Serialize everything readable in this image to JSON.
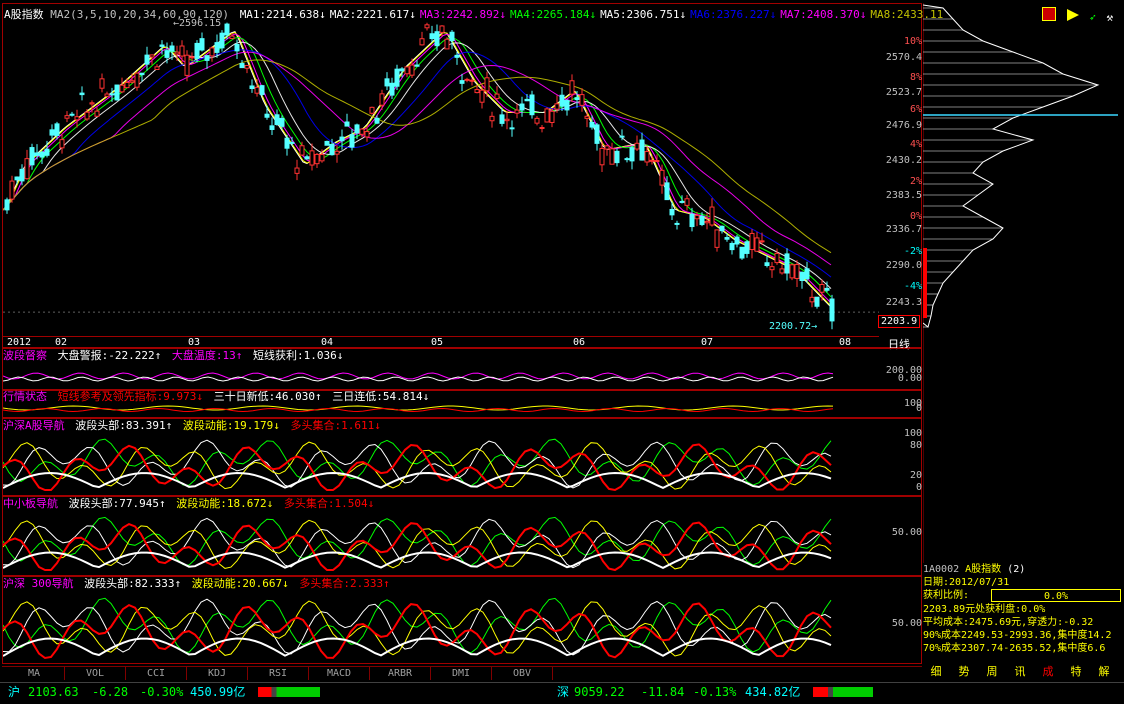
{
  "main": {
    "index_name": "A股指数",
    "ma_params": "MA2(3,5,10,20,34,60,90,120)",
    "ma_values": [
      {
        "label": "MA1:2214.638↓",
        "color": "#ffffff"
      },
      {
        "label": "MA2:2221.617↓",
        "color": "#ffffff"
      },
      {
        "label": "MA3:2242.892↓",
        "color": "#ff00ff"
      },
      {
        "label": "MA4:2265.184↓",
        "color": "#00ff00"
      },
      {
        "label": "MA5:2306.751↓",
        "color": "#ffffff"
      },
      {
        "label": "MA6:2376.227↓",
        "color": "#0000ff"
      },
      {
        "label": "MA7:2408.370↓",
        "color": "#ff00ff"
      },
      {
        "label": "MA8:2433.11",
        "color": "#c0c000"
      }
    ],
    "high_label": "2596.15",
    "low_label": "2200.72",
    "last_price": "2203.9",
    "price_axis": [
      "2570.4",
      "2523.7",
      "2476.9",
      "2430.2",
      "2383.5",
      "2336.7",
      "2290.0",
      "2243.3"
    ],
    "pct_axis": [
      "10%",
      "8%",
      "6%",
      "4%",
      "2%",
      "0%",
      "-2%",
      "-4%"
    ],
    "month_labels": [
      "2012",
      "02",
      "03",
      "04",
      "05",
      "06",
      "07",
      "08"
    ],
    "period": "日线"
  },
  "sub1": {
    "name": "波段督察",
    "items": [
      {
        "text": "大盘警报:-22.222↑",
        "color": "#ffffff"
      },
      {
        "text": "大盘温度:13↑",
        "color": "#ff00ff"
      },
      {
        "text": "短线获利:1.036↓",
        "color": "#ffffff"
      }
    ],
    "axis": [
      "200.00",
      "0.00"
    ]
  },
  "sub2": {
    "name": "行情状态",
    "items": [
      {
        "text": "短线参考及领先指标:9.973↓",
        "color": "#ff0000"
      },
      {
        "text": "三十日新低:46.030↑",
        "color": "#ffffff"
      },
      {
        "text": "三日连低:54.814↓",
        "color": "#ffffff"
      }
    ],
    "axis": [
      "100",
      "0"
    ]
  },
  "sub3": {
    "name": "沪深A股导航",
    "items": [
      {
        "text": "波段头部:83.391↑",
        "color": "#ffffff"
      },
      {
        "text": "波段动能:19.179↓",
        "color": "#ffff00"
      },
      {
        "text": "多头集合:1.611↓",
        "color": "#ff0000"
      }
    ],
    "axis": [
      "100",
      "80",
      "20",
      "0"
    ]
  },
  "sub4": {
    "name": "中小板导航",
    "items": [
      {
        "text": "波段头部:77.945↑",
        "color": "#ffffff"
      },
      {
        "text": "波段动能:18.672↓",
        "color": "#ffff00"
      },
      {
        "text": "多头集合:1.504↓",
        "color": "#ff0000"
      }
    ],
    "axis": [
      "50.00"
    ]
  },
  "sub5": {
    "name": "沪深 300导航",
    "items": [
      {
        "text": "波段头部:82.333↑",
        "color": "#ffffff"
      },
      {
        "text": "波段动能:20.667↓",
        "color": "#ffff00"
      },
      {
        "text": "多头集合:2.333↑",
        "color": "#ff0000"
      }
    ],
    "axis": [
      "50.00"
    ]
  },
  "tabs": [
    "MA",
    "VOL",
    "CCI",
    "KDJ",
    "RSI",
    "MACD",
    "ARBR",
    "DMI",
    "OBV"
  ],
  "info": {
    "code": "1A0002",
    "name": "A股指数",
    "num": "(2)",
    "date": "日期:2012/07/31",
    "ratio_label": "获利比例:",
    "ratio_value": "0.0%",
    "lines": [
      "2203.89元处获利盘:0.0%",
      "平均成本:2475.69元,穿透力:-0.32",
      "90%成本2249.53-2993.36,集中度14.2",
      "70%成本2307.74-2635.52,集中度6.6"
    ]
  },
  "right_buttons": [
    "细",
    "势",
    "周",
    "讯",
    "成",
    "特",
    "解"
  ],
  "status": {
    "sh_label": "沪",
    "sh_value": "2103.63",
    "sh_change": "-6.28",
    "sh_pct": "-0.30%",
    "sh_amount": "450.99亿",
    "sz_label": "深",
    "sz_value": "9059.22",
    "sz_change": "-11.84",
    "sz_pct": "-0.13%",
    "sz_amount": "434.82亿"
  }
}
